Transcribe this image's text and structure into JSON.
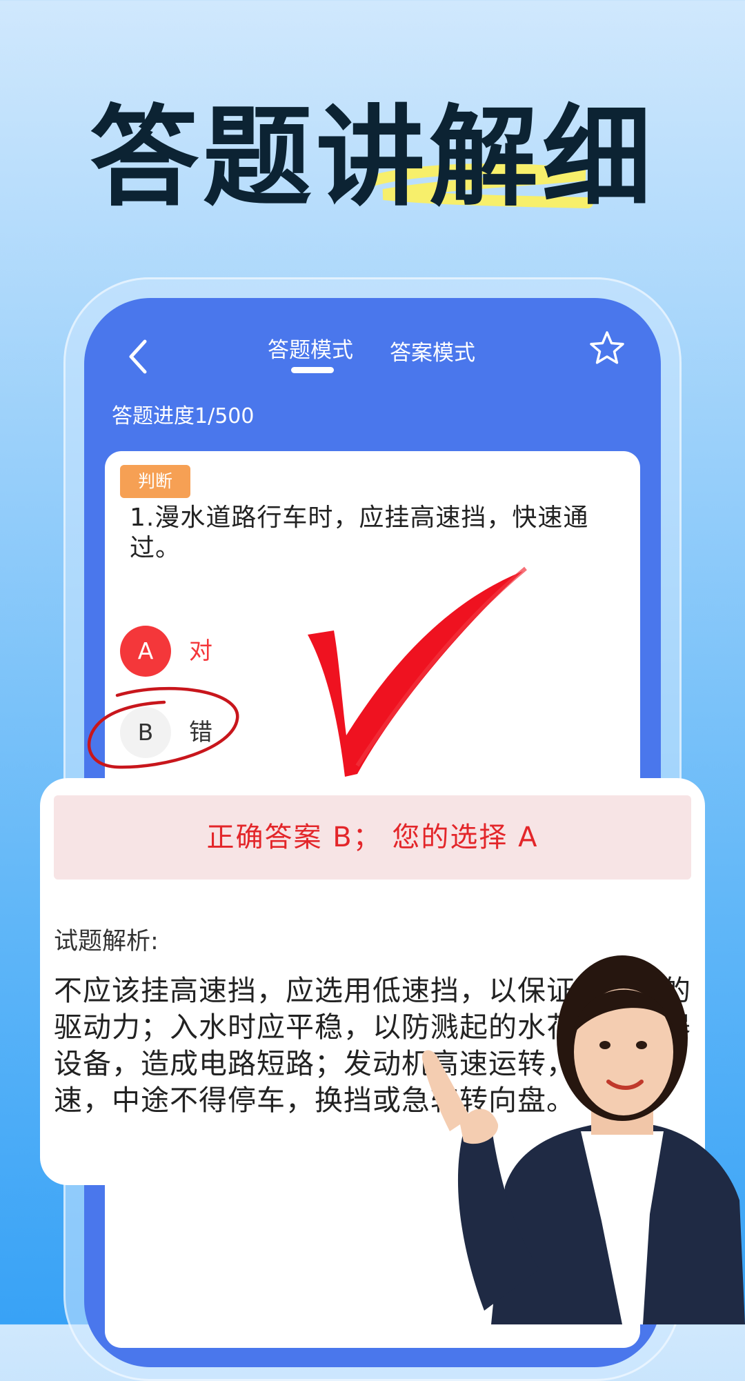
{
  "headline": "答题讲解细",
  "colors": {
    "screen_bg": "#4a77ec",
    "badge": "#f6a054",
    "selected_wrong": "#f4373a",
    "answer_banner_bg": "#f7e4e5",
    "answer_banner_text": "#e3262a",
    "highlight_stroke": "#f7ef6b"
  },
  "nav": {
    "back_icon": "chevron-left-icon",
    "tabs": [
      {
        "label": "答题模式",
        "active": true
      },
      {
        "label": "答案模式",
        "active": false
      }
    ],
    "favorite_icon": "star-outline-icon"
  },
  "progress_label": "答题进度1/500",
  "question": {
    "type_badge": "判断",
    "text": "1.漫水道路行车时，应挂高速挡，快速通过。",
    "options": [
      {
        "letter": "A",
        "text": "对",
        "state": "selected-wrong"
      },
      {
        "letter": "B",
        "text": "错",
        "state": "correct"
      }
    ]
  },
  "result": {
    "banner": "正确答案 B； 您的选择 A"
  },
  "analysis": {
    "title": "试题解析:",
    "body": "不应该挂高速挡，应选用低速挡，以保证有足够的驱动力；入水时应平稳，以防溅起的水花落入电器设备，造成电路短路；发动机高速运转，保持车速，中途不得停车，换挡或急转转向盘。"
  }
}
